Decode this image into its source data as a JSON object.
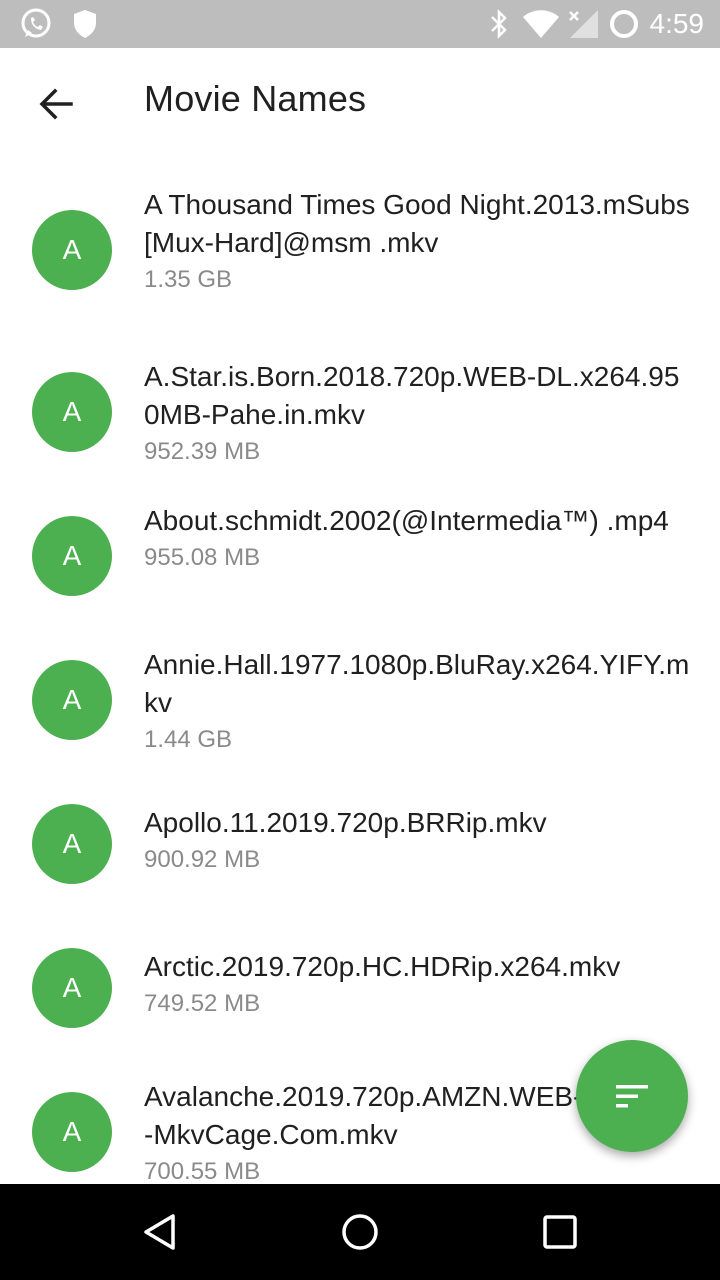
{
  "status_bar": {
    "time": "4:59",
    "icons": [
      "whatsapp-icon",
      "shield-icon",
      "bluetooth-icon",
      "wifi-icon",
      "signal-icon",
      "sync-icon"
    ]
  },
  "app_bar": {
    "back_icon": "arrow-back-icon",
    "title": "Movie Names"
  },
  "colors": {
    "accent": "#4caf50",
    "status_bar": "#bdbdbd",
    "title_text": "#202020",
    "secondary_text": "#8a8a8a"
  },
  "movies": [
    {
      "initial": "A",
      "name": "A Thousand Times Good Night.2013.mSubs[Mux-Hard]@msm .mkv",
      "size": "1.35 GB"
    },
    {
      "initial": "A",
      "name": "A.Star.is.Born.2018.720p.WEB-DL.x264.950MB-Pahe.in.mkv",
      "size": "952.39 MB"
    },
    {
      "initial": "A",
      "name": "About.schmidt.2002(@Intermedia™) .mp4",
      "size": "955.08 MB"
    },
    {
      "initial": "A",
      "name": "Annie.Hall.1977.1080p.BluRay.x264.YIFY.mkv",
      "size": "1.44 GB"
    },
    {
      "initial": "A",
      "name": "Apollo.11.2019.720p.BRRip.mkv",
      "size": "900.92 MB"
    },
    {
      "initial": "A",
      "name": "Arctic.2019.720p.HC.HDRip.x264.mkv",
      "size": "749.52 MB"
    },
    {
      "initial": "A",
      "name": "Avalanche.2019.720p.AMZN.WEB-DL.x264-MkvCage.Com.mkv",
      "size": "700.55 MB"
    }
  ],
  "fab": {
    "icon": "sort-icon"
  },
  "nav_bar": {
    "icons": [
      "back-triangle-icon",
      "home-circle-icon",
      "recents-square-icon"
    ]
  }
}
